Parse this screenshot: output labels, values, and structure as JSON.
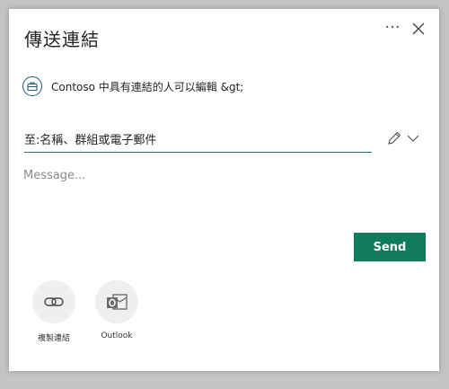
{
  "dialog": {
    "title": "傳送連結",
    "more_label": "···",
    "close_label": "Close"
  },
  "permission": {
    "icon": "briefcase-icon",
    "text": "Contoso 中具有連結的人可以編輯 &gt;"
  },
  "to_field": {
    "placeholder": "至:名稱、群組或電子郵件"
  },
  "message": {
    "placeholder": "Message..."
  },
  "send_button": {
    "label": "Send"
  },
  "share_options": [
    {
      "label": "複製連結",
      "icon": "link-icon"
    },
    {
      "label": "Outlook",
      "icon": "outlook-icon"
    }
  ],
  "colors": {
    "accent": "#107c5c",
    "underline": "#1f6f8b"
  }
}
